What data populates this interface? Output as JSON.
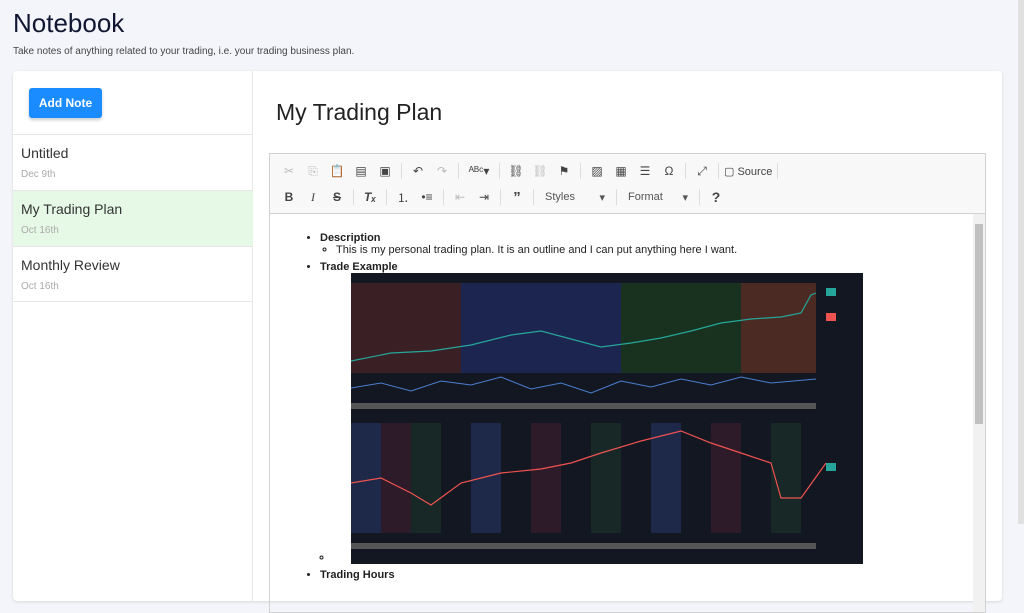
{
  "header": {
    "title": "Notebook",
    "subtitle": "Take notes of anything related to your trading, i.e. your trading business plan."
  },
  "sidebar": {
    "add_label": "Add Note",
    "notes": [
      {
        "name": "Untitled",
        "date": "Dec 9th"
      },
      {
        "name": "My Trading Plan",
        "date": "Oct 16th",
        "selected": true
      },
      {
        "name": "Monthly Review",
        "date": "Oct 16th"
      }
    ]
  },
  "note": {
    "title": "My Trading Plan"
  },
  "toolbar": {
    "source_label": "Source",
    "styles_label": "Styles",
    "format_label": "Format",
    "help_label": "?"
  },
  "content": {
    "description_heading": "Description",
    "description_text": "This is my personal trading plan. It is an outline and I can put anything here I want.",
    "trade_example_heading": "Trade Example",
    "trading_hours_heading": "Trading Hours"
  }
}
